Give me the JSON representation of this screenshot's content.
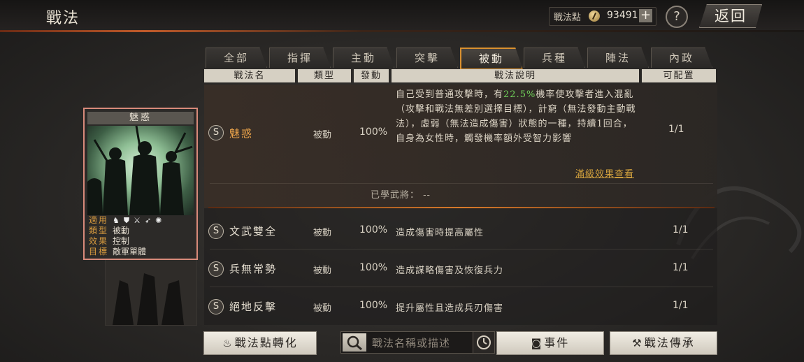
{
  "header": {
    "title": "戰法",
    "points_label": "戰法點",
    "points_value": "93491",
    "plus": "+",
    "help": "?",
    "back": "返回"
  },
  "tabs": [
    {
      "label": "全部",
      "active": false
    },
    {
      "label": "指揮",
      "active": false
    },
    {
      "label": "主動",
      "active": false
    },
    {
      "label": "突擊",
      "active": false
    },
    {
      "label": "被動",
      "active": true
    },
    {
      "label": "兵種",
      "active": false
    },
    {
      "label": "陣法",
      "active": false
    },
    {
      "label": "內政",
      "active": false
    }
  ],
  "columns": {
    "name": "戰法名",
    "type": "類型",
    "trigger": "發動",
    "desc": "戰法說明",
    "config": "可配置"
  },
  "selected": {
    "grade": "S",
    "name": "魅惑",
    "type": "被動",
    "trigger": "100%",
    "desc_pre": "自己受到普通攻擊時，有",
    "desc_hl": "22.5%",
    "desc_post": "機率使攻擊者進入混亂（攻擊和戰法無差別選擇目標），計窮（無法發動主動戰法），虛弱（無法造成傷害）狀態的一種，持續1回合，自身為女性時，觸發機率額外受智力影響",
    "config": "1/1",
    "more": "滿級效果查看",
    "learned_label": "已學武將：",
    "learned_value": "--"
  },
  "rows": [
    {
      "grade": "S",
      "name": "文武雙全",
      "type": "被動",
      "trigger": "100%",
      "desc": "造成傷害時提高屬性",
      "config": "1/1"
    },
    {
      "grade": "S",
      "name": "兵無常勢",
      "type": "被動",
      "trigger": "100%",
      "desc": "造成謀略傷害及恢復兵力",
      "config": "1/1"
    },
    {
      "grade": "S",
      "name": "絕地反擊",
      "type": "被動",
      "trigger": "100%",
      "desc": "提升屬性且造成兵刃傷害",
      "config": "1/1"
    }
  ],
  "card": {
    "title": "魅惑",
    "apply_label": "適用",
    "apply_icons": [
      "cavalry-icon",
      "shield-icon",
      "crossed-weapons-icon",
      "bow-icon",
      "siege-icon"
    ],
    "type_label": "類型",
    "type_value": "被動",
    "effect_label": "效果",
    "effect_value": "控制",
    "target_label": "目標",
    "target_value": "敵軍單體"
  },
  "bottom": {
    "convert": "戰法點轉化",
    "search_placeholder": "戰法名稱或描述",
    "event": "事件",
    "inherit": "戰法傳承"
  },
  "colors": {
    "accent_orange": "#d9902f",
    "highlight_green": "#6fd05a",
    "selected_name": "#e9a24a",
    "link_gold": "#d2a13d"
  }
}
